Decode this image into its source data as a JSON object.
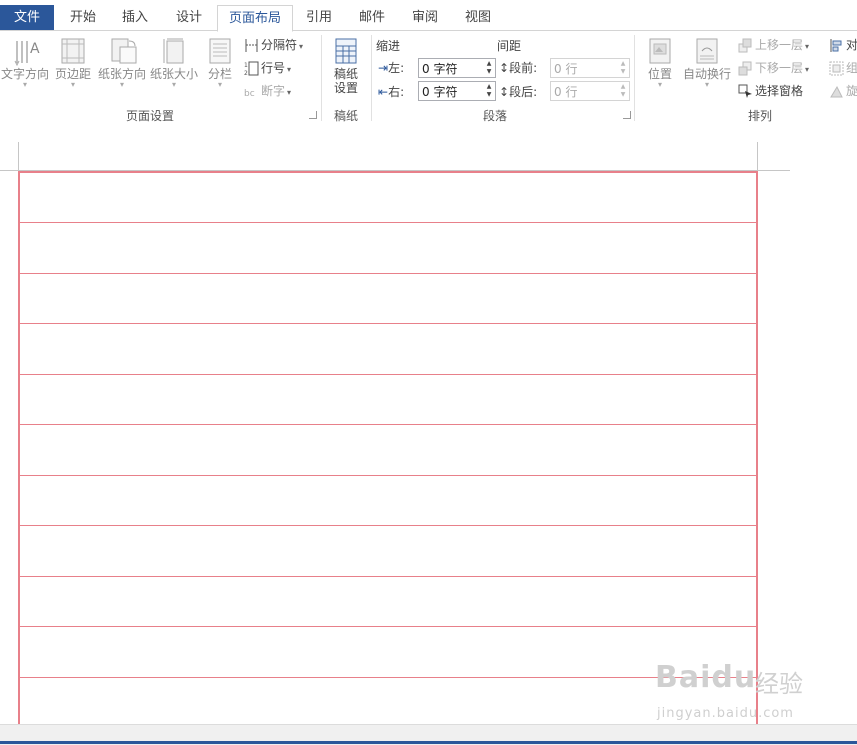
{
  "tabs": {
    "file": "文件",
    "items": [
      "开始",
      "插入",
      "设计",
      "页面布局",
      "引用",
      "邮件",
      "审阅",
      "视图"
    ],
    "active": "页面布局"
  },
  "page_setup": {
    "text_direction": "文字方向",
    "margins": "页边距",
    "orientation": "纸张方向",
    "size": "纸张大小",
    "columns": "分栏",
    "breaks": "分隔符",
    "line_numbers": "行号",
    "hyphenation": "断字",
    "group_label": "页面设置"
  },
  "manuscript": {
    "setup_line1": "稿纸",
    "setup_line2": "设置",
    "group_label": "稿纸"
  },
  "paragraph": {
    "indent_title": "缩进",
    "spacing_title": "间距",
    "left_label": "左:",
    "left_value": "0 字符",
    "right_label": "右:",
    "right_value": "0 字符",
    "before_label": "段前:",
    "before_value": "0 行",
    "after_label": "段后:",
    "after_value": "0 行",
    "group_label": "段落"
  },
  "arrange": {
    "position": "位置",
    "wrap_text": "自动换行",
    "bring_forward": "上移一层",
    "send_backward": "下移一层",
    "selection_pane": "选择窗格",
    "align": "对",
    "group": "组",
    "rotate": "旋",
    "group_label": "排列"
  },
  "watermark": {
    "logo": "Baidu",
    "cn": "经验",
    "url": "jingyan.baidu.com"
  },
  "colors": {
    "accent": "#2b579a",
    "grid_line": "#e8808a"
  }
}
